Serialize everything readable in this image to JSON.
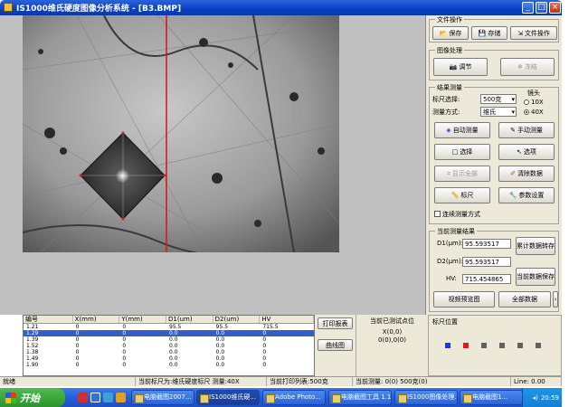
{
  "window": {
    "title": "IS1000维氏硬度图像分析系统 - [B3.BMP]"
  },
  "right_panel": {
    "file_group": {
      "title": "文件操作",
      "buttons": [
        "保存",
        "存储",
        "文件操作"
      ]
    },
    "image_group": {
      "title": "图像处理",
      "buttons": [
        "调节",
        "冻结"
      ]
    },
    "measure_group": {
      "title": "结果测量",
      "scale_label": "标尺选择:",
      "scale_value": "500克",
      "mode_label": "测量方式:",
      "mode_value": "维氏",
      "lens_label": "镜头",
      "lens_options": [
        "10X",
        "40X"
      ],
      "lens_selected": 1,
      "buttons": [
        "自动测量",
        "手动测量",
        "选择",
        "选项",
        "显示全部",
        "清除数据",
        "标尺",
        "参数设置"
      ],
      "continuous_label": "连续测量方式"
    },
    "result_group": {
      "title": "当前测量结果",
      "d1_label": "D1(μm):",
      "d1_value": "95.593517",
      "d2_label": "D2(μm):",
      "d2_value": "95.593517",
      "hv_label": "HV:",
      "hv_value": "715.454865",
      "btn_next": "累计数据转存",
      "btn_current": "当前数据保存",
      "btn_video": "视频预览图",
      "btn_all": "全部数据"
    }
  },
  "table": {
    "headers": [
      "编号",
      "X(mm)",
      "Y(mm)",
      "D1(um)",
      "D2(um)",
      "HV"
    ],
    "rows": [
      [
        "1.21",
        "0",
        "0",
        "95.5",
        "95.5",
        "715.5"
      ],
      [
        "1.29",
        "0",
        "0",
        "0.0",
        "0.0",
        "0"
      ],
      [
        "1.39",
        "0",
        "0",
        "0.0",
        "0.0",
        "0"
      ],
      [
        "1.52",
        "0",
        "0",
        "0.0",
        "0.0",
        "0"
      ],
      [
        "1.38",
        "0",
        "0",
        "0.0",
        "0.0",
        "0"
      ],
      [
        "1.49",
        "0",
        "0",
        "0.0",
        "0.0",
        "0"
      ],
      [
        "1.90",
        "0",
        "0",
        "0.0",
        "0.0",
        "0"
      ]
    ],
    "selected_row": 1
  },
  "mid_buttons": [
    "打印报表",
    "曲线图"
  ],
  "info_box": {
    "title": "当前已测试点位",
    "line1": "X(0,0)",
    "line2": "0(0),0(0)"
  },
  "ruler_box": {
    "title": "标尺位置",
    "square_colors": [
      "#1a3ae0",
      "#e01a1a",
      "#606060",
      "#606060",
      "#606060",
      "#606060"
    ]
  },
  "status_bar": [
    "就绪",
    "当前标尺为:维氏硬度标尺 测量:40X",
    "当前打印列表:500克",
    "当前测量: 0(0) 500克(0)",
    "Line: 0.00"
  ],
  "taskbar": {
    "start_label": "开始",
    "tasks": [
      "电脑截图2007...",
      "IS1000维氏硬...",
      "Adobe Photo...",
      "电脑截图工具 1.1",
      "IS1000图像处理...",
      "电脑截图1..."
    ],
    "clock": "20:59"
  }
}
